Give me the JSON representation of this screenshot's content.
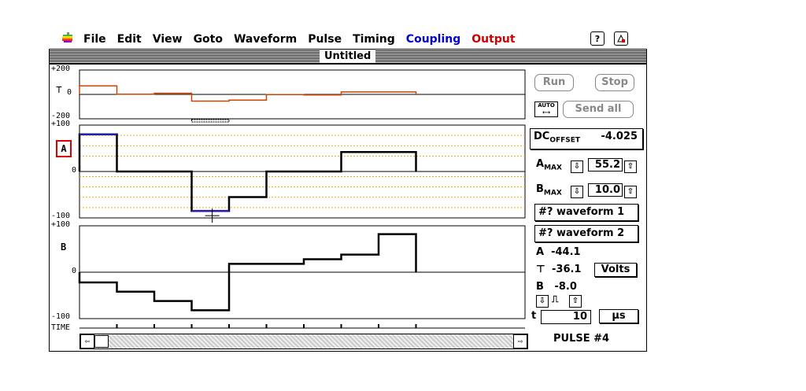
{
  "menu": {
    "items": [
      {
        "label": "File",
        "color": "#000000"
      },
      {
        "label": "Edit",
        "color": "#000000"
      },
      {
        "label": "View",
        "color": "#000000"
      },
      {
        "label": "Goto",
        "color": "#000000"
      },
      {
        "label": "Waveform",
        "color": "#000000"
      },
      {
        "label": "Pulse",
        "color": "#000000"
      },
      {
        "label": "Timing",
        "color": "#000000"
      },
      {
        "label": "Coupling",
        "color": "#0000cc"
      },
      {
        "label": "Output",
        "color": "#cc0000"
      }
    ],
    "help_icon": "?",
    "app_icon": "app-icon"
  },
  "window": {
    "title": "Untitled"
  },
  "plot_top": {
    "y_max": "+200",
    "y_zero": "0",
    "y_min": "-200"
  },
  "plot_a": {
    "label": "A",
    "y_max": "+100",
    "y_zero": "0",
    "y_min": "-100"
  },
  "plot_b": {
    "label": "B",
    "y_max": "+100",
    "y_zero": "0",
    "y_min": "-100"
  },
  "time_label": "TIME",
  "panel": {
    "run": "Run",
    "stop": "Stop",
    "auto": "AUTO",
    "send_all": "Send all",
    "dc_offset_main": "DC",
    "dc_offset_sub": "OFFSET",
    "dc_offset_value": "-4.025",
    "amax_main": "A",
    "amax_sub": "MAX",
    "amax_value": "55.2",
    "bmax_main": "B",
    "bmax_sub": "MAX",
    "bmax_value": "10.0",
    "waveform1": "#? waveform 1",
    "waveform2": "#? waveform 2",
    "a_readout": "A  -44.1",
    "mid_readout": "-36.1",
    "units": "Volts",
    "b_readout": "B   -8.0",
    "t_label": "t",
    "t_value": "10",
    "t_unit": "µs",
    "pulse": "PULSE #4"
  },
  "chart_data": [
    {
      "type": "line",
      "name": "top",
      "ylim": [
        -200,
        200
      ],
      "values": [
        70,
        2,
        10,
        -55,
        -47,
        -2,
        -5,
        20,
        20
      ],
      "color": "#cc4400"
    },
    {
      "type": "line",
      "name": "A",
      "ylim": [
        -100,
        100
      ],
      "values": [
        80,
        0,
        0,
        -85,
        -55,
        0,
        0,
        42,
        42
      ],
      "color": "#000000"
    },
    {
      "type": "line",
      "name": "B",
      "ylim": [
        -100,
        100
      ],
      "values": [
        -22,
        -42,
        -62,
        -82,
        18,
        18,
        28,
        38,
        82
      ],
      "color": "#000000"
    }
  ]
}
